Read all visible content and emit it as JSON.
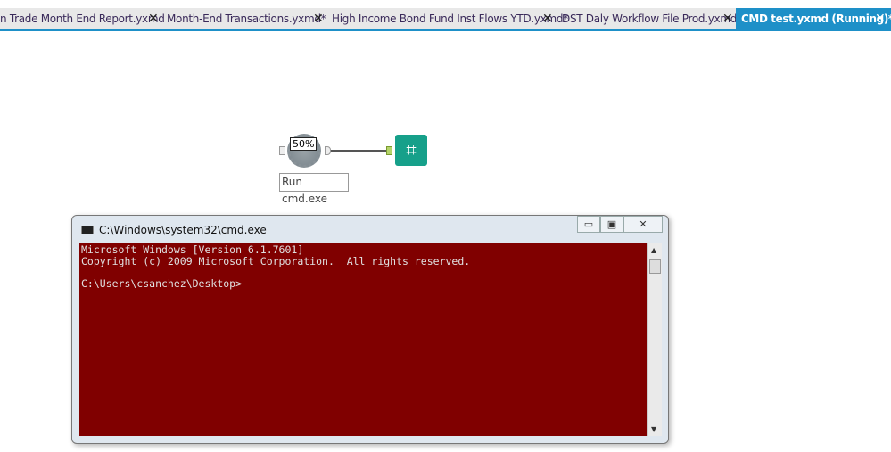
{
  "tabs": [
    {
      "label": "n Trade Month End Report.yxmd",
      "close": "✕"
    },
    {
      "label": "Month-End Transactions.yxmd*",
      "close": "✕"
    },
    {
      "label": "High Income Bond Fund Inst Flows YTD.yxmd*",
      "close": "✕"
    },
    {
      "label": "DST Daly Workflow File Prod.yxmd",
      "close": "✕"
    },
    {
      "label": "CMD test.yxmd (Running)*",
      "close": "✕",
      "active": true
    }
  ],
  "workflow": {
    "progress": "50%",
    "progress_value": 50,
    "tool_label": "Run cmd.exe",
    "browse_icon": "binoculars-icon"
  },
  "cmd": {
    "title": "C:\\Windows\\system32\\cmd.exe",
    "minimize": "▭",
    "restore": "▣",
    "close": "✕",
    "lines": [
      "Microsoft Windows [Version 6.1.7601]",
      "Copyright (c) 2009 Microsoft Corporation.  All rights reserved.",
      "",
      "C:\\Users\\csanchez\\Desktop>"
    ]
  },
  "colors": {
    "accent": "#1e90c8",
    "console_bg": "#800000",
    "browse": "#16a08a"
  }
}
